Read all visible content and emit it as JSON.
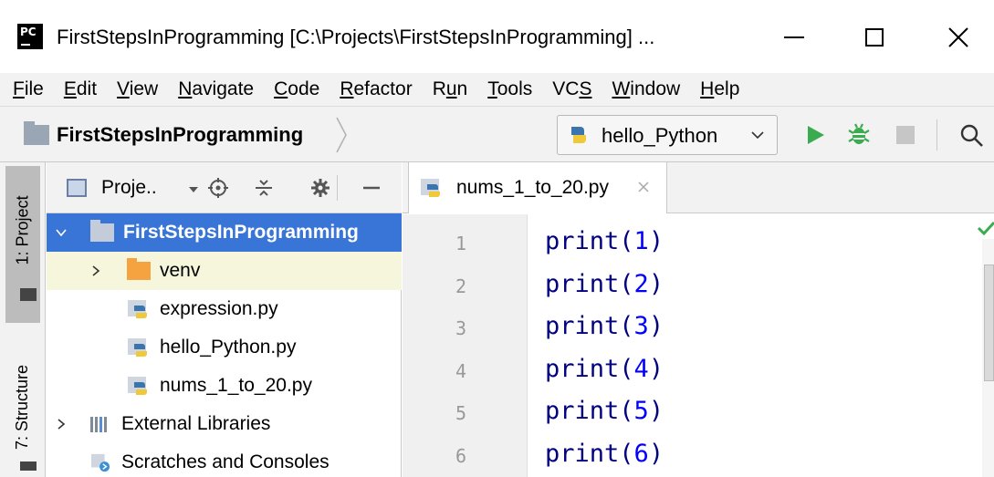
{
  "window": {
    "app_icon_text": "PC",
    "title": "FirstStepsInProgramming [C:\\Projects\\FirstStepsInProgramming] ..."
  },
  "menu": {
    "items": [
      {
        "label": "File",
        "mnemonic_index": 0
      },
      {
        "label": "Edit",
        "mnemonic_index": 0
      },
      {
        "label": "View",
        "mnemonic_index": 0
      },
      {
        "label": "Navigate",
        "mnemonic_index": 0
      },
      {
        "label": "Code",
        "mnemonic_index": 0
      },
      {
        "label": "Refactor",
        "mnemonic_index": 0
      },
      {
        "label": "Run",
        "mnemonic_index": 1
      },
      {
        "label": "Tools",
        "mnemonic_index": 0
      },
      {
        "label": "VCS",
        "mnemonic_index": 2
      },
      {
        "label": "Window",
        "mnemonic_index": 0
      },
      {
        "label": "Help",
        "mnemonic_index": 0
      }
    ]
  },
  "navbar": {
    "breadcrumb": "FirstStepsInProgramming",
    "run_config": "hello_Python"
  },
  "stripe": {
    "project_tab": "1: Project",
    "structure_tab": "7: Structure"
  },
  "project_panel": {
    "header_label": "Proje..",
    "tree": [
      {
        "label": "FirstStepsInProgramming",
        "type": "project-root",
        "expanded": true,
        "selected": true
      },
      {
        "label": "venv",
        "type": "folder",
        "expanded": false
      },
      {
        "label": "expression.py",
        "type": "python-file"
      },
      {
        "label": "hello_Python.py",
        "type": "python-file"
      },
      {
        "label": "nums_1_to_20.py",
        "type": "python-file"
      },
      {
        "label": "External Libraries",
        "type": "libraries",
        "expanded": false
      },
      {
        "label": "Scratches and Consoles",
        "type": "scratches"
      }
    ]
  },
  "editor": {
    "active_tab": "nums_1_to_20.py",
    "lines": [
      {
        "number": "1",
        "fn": "print",
        "arg": "1"
      },
      {
        "number": "2",
        "fn": "print",
        "arg": "2"
      },
      {
        "number": "3",
        "fn": "print",
        "arg": "3"
      },
      {
        "number": "4",
        "fn": "print",
        "arg": "4"
      },
      {
        "number": "5",
        "fn": "print",
        "arg": "5"
      },
      {
        "number": "6",
        "fn": "print",
        "arg": "6"
      }
    ]
  },
  "colors": {
    "selection": "#3875d7",
    "run_green": "#3bab4f",
    "folder_orange": "#f4a340",
    "keyword_navy": "#000080",
    "number_blue": "#0000ff"
  }
}
